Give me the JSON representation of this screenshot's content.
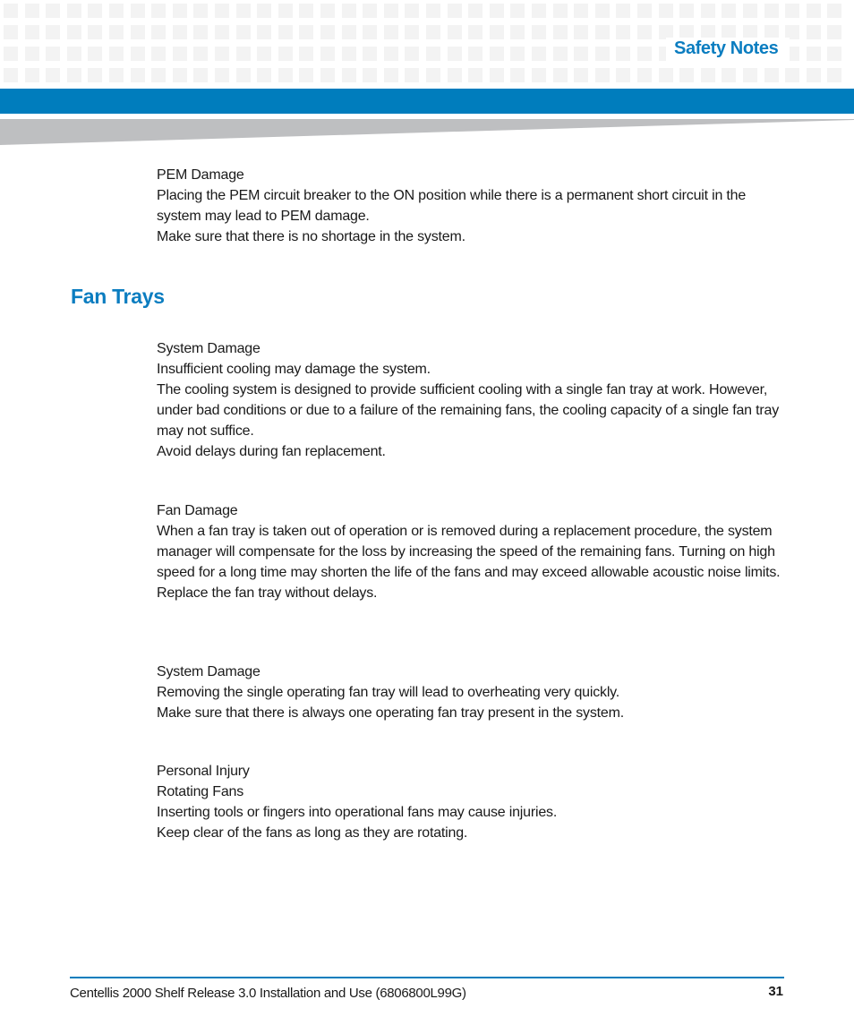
{
  "header": {
    "section_title": "Safety Notes"
  },
  "colors": {
    "accent_blue": "#007dbd",
    "title_blue": "#0b7dc0",
    "wedge_gray": "#bebfc1",
    "grid_gray": "#f3f3f3"
  },
  "intro_notice": {
    "heading": "PEM Damage",
    "lines": [
      "Placing the PEM circuit breaker to the ON position while there is a permanent short circuit in the system may lead to PEM damage.",
      "Make sure that there is no shortage in the system."
    ]
  },
  "section": {
    "title": "Fan Trays",
    "notices": [
      {
        "heading": "System Damage",
        "lines": [
          "Insufficient cooling may damage the system.",
          "The cooling system is designed to provide sufficient cooling with a single fan tray at work. However, under bad conditions or due to a failure of the remaining fans, the cooling capacity of a single fan tray may not suffice.",
          "Avoid delays during fan replacement."
        ]
      },
      {
        "heading": "Fan Damage",
        "lines": [
          "When a fan tray is taken out of operation or is removed during a replacement procedure, the system manager will compensate for the loss by increasing the speed of the remaining fans. Turning on high speed for a long time may shorten the life of the fans and may exceed allowable acoustic noise limits.",
          "Replace the fan tray without delays."
        ]
      },
      {
        "heading": "System Damage",
        "lines": [
          "Removing the single operating fan tray will lead to overheating very quickly.",
          "Make sure that there is always one operating fan tray present in the system."
        ]
      },
      {
        "heading": "Personal Injury",
        "lines": [
          "Rotating Fans",
          "Inserting tools or fingers into operational fans may cause injuries.",
          "Keep clear of the fans as long as they are rotating."
        ]
      }
    ]
  },
  "footer": {
    "document_title": "Centellis 2000 Shelf Release 3.0 Installation and Use (6806800L99G)",
    "page_number": "31"
  }
}
